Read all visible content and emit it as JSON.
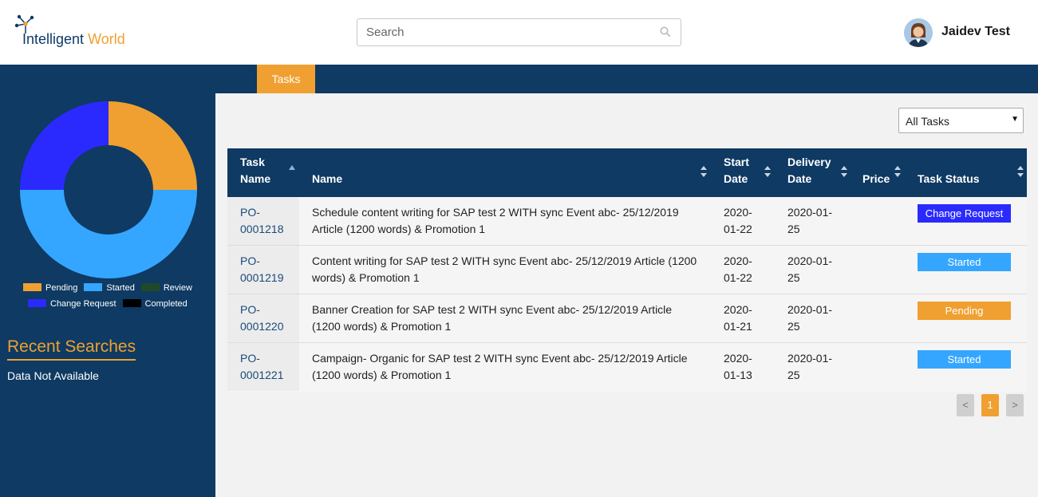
{
  "brand": {
    "word1": "Intelligent",
    "word2": " World"
  },
  "search": {
    "placeholder": "Search"
  },
  "user": {
    "name": "Jaidev Test"
  },
  "nav": {
    "tasks_tab": "Tasks"
  },
  "colors": {
    "navy": "#0e3a63",
    "accent": "#f0a030",
    "pending": "#f0a030",
    "started": "#35a6ff",
    "review": "#1f4a2a",
    "change_request": "#2a2aff",
    "completed": "#000000"
  },
  "sidebar": {
    "legend": [
      {
        "label": "Pending",
        "color": "#f0a030"
      },
      {
        "label": "Started",
        "color": "#35a6ff"
      },
      {
        "label": "Review",
        "color": "#1f4a2a"
      },
      {
        "label": "Change Request",
        "color": "#2a2aff"
      },
      {
        "label": "Completed",
        "color": "#000000"
      }
    ],
    "recent_title": "Recent Searches",
    "recent_empty": "Data Not Available"
  },
  "chart_data": {
    "type": "pie",
    "donut": true,
    "categories": [
      "Pending",
      "Started",
      "Review",
      "Change Request",
      "Completed"
    ],
    "values": [
      1,
      2,
      0,
      1,
      0
    ],
    "legend": "bottom"
  },
  "filter": {
    "value": "All Tasks"
  },
  "table": {
    "headers": {
      "task_name": "Task Name",
      "name": "Name",
      "start_date": "Start Date",
      "delivery_date": "Delivery Date",
      "price": "Price",
      "task_status": "Task Status"
    },
    "rows": [
      {
        "id_a": "PO-",
        "id_b": "0001218",
        "name": "Schedule content writing for SAP test 2 WITH sync Event abc- 25/12/2019 Article (1200 words) & Promotion 1",
        "start_a": "2020-",
        "start_b": "01-22",
        "del_a": "2020-01-",
        "del_b": "25",
        "price": "",
        "status": "Change Request",
        "status_color": "#2a2aff"
      },
      {
        "id_a": "PO-",
        "id_b": "0001219",
        "name": "Content writing for SAP test 2 WITH sync Event abc- 25/12/2019 Article (1200 words) & Promotion 1",
        "start_a": "2020-",
        "start_b": "01-22",
        "del_a": "2020-01-",
        "del_b": "25",
        "price": "",
        "status": "Started",
        "status_color": "#35a6ff"
      },
      {
        "id_a": "PO-",
        "id_b": "0001220",
        "name": "Banner Creation for SAP test 2 WITH sync Event abc- 25/12/2019 Article (1200 words) & Promotion 1",
        "start_a": "2020-",
        "start_b": "01-21",
        "del_a": "2020-01-",
        "del_b": "25",
        "price": "",
        "status": "Pending",
        "status_color": "#f0a030"
      },
      {
        "id_a": "PO-",
        "id_b": "0001221",
        "name": "Campaign- Organic for SAP test 2 WITH sync Event abc- 25/12/2019 Article (1200 words) & Promotion 1",
        "start_a": "2020-",
        "start_b": "01-13",
        "del_a": "2020-01-",
        "del_b": "25",
        "price": "",
        "status": "Started",
        "status_color": "#35a6ff"
      }
    ]
  },
  "pagination": {
    "prev": "<",
    "current": "1",
    "next": ">"
  }
}
